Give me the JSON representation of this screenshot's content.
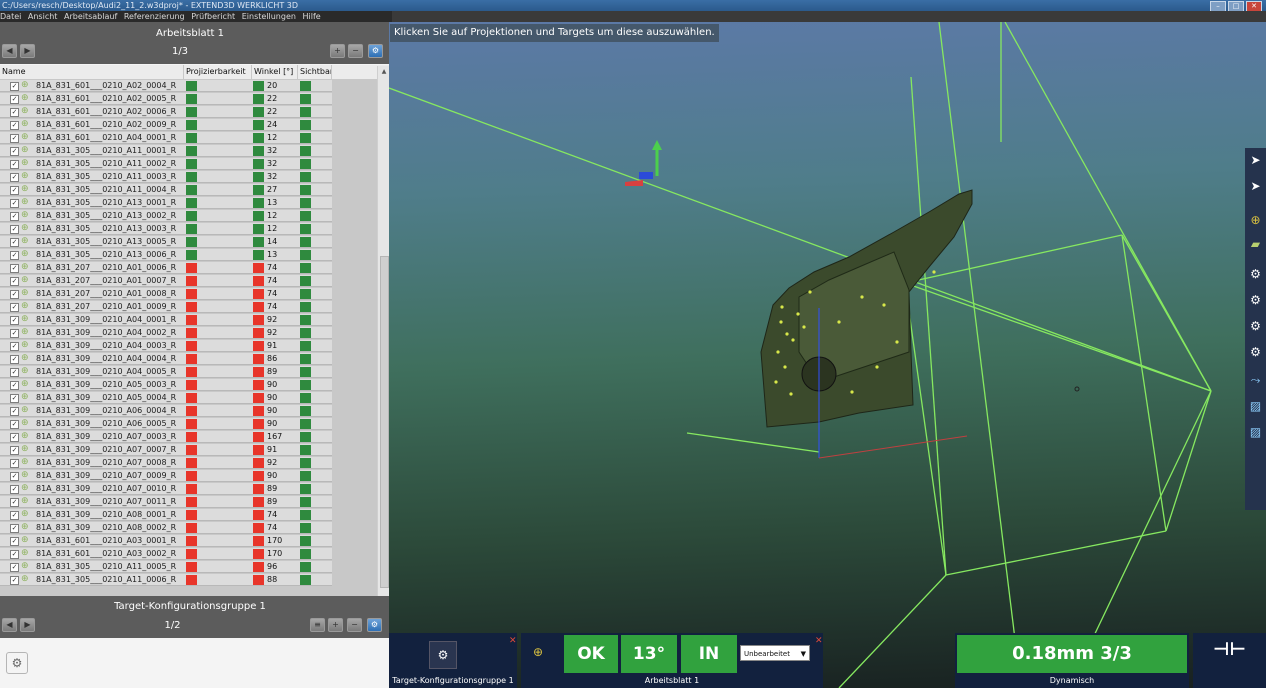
{
  "window": {
    "title": "C:/Users/resch/Desktop/Audi2_11_2.w3dproj* - EXTEND3D WERKLICHT 3D"
  },
  "menu": [
    "Datei",
    "Ansicht",
    "Arbeitsablauf",
    "Referenzierung",
    "Prüfbericht",
    "Einstellungen",
    "Hilfe"
  ],
  "worksheet": {
    "title": "Arbeitsblatt 1",
    "page": "1/3",
    "columns": [
      "Name",
      "Projizierbarkeit",
      "Winkel [°]",
      "Sichtbar"
    ],
    "rows": [
      {
        "name": "81A_831_601___0210_A02_0004_R",
        "ok": true,
        "angle": "20"
      },
      {
        "name": "81A_831_601___0210_A02_0005_R",
        "ok": true,
        "angle": "22"
      },
      {
        "name": "81A_831_601___0210_A02_0006_R",
        "ok": true,
        "angle": "22"
      },
      {
        "name": "81A_831_601___0210_A02_0009_R",
        "ok": true,
        "angle": "24"
      },
      {
        "name": "81A_831_601___0210_A04_0001_R",
        "ok": true,
        "angle": "12"
      },
      {
        "name": "81A_831_305___0210_A11_0001_R",
        "ok": true,
        "angle": "32"
      },
      {
        "name": "81A_831_305___0210_A11_0002_R",
        "ok": true,
        "angle": "32"
      },
      {
        "name": "81A_831_305___0210_A11_0003_R",
        "ok": true,
        "angle": "32"
      },
      {
        "name": "81A_831_305___0210_A11_0004_R",
        "ok": true,
        "angle": "27"
      },
      {
        "name": "81A_831_305___0210_A13_0001_R",
        "ok": true,
        "angle": "13"
      },
      {
        "name": "81A_831_305___0210_A13_0002_R",
        "ok": true,
        "angle": "12"
      },
      {
        "name": "81A_831_305___0210_A13_0003_R",
        "ok": true,
        "angle": "12"
      },
      {
        "name": "81A_831_305___0210_A13_0005_R",
        "ok": true,
        "angle": "14"
      },
      {
        "name": "81A_831_305___0210_A13_0006_R",
        "ok": true,
        "angle": "13"
      },
      {
        "name": "81A_831_207___0210_A01_0006_R",
        "ok": false,
        "angle": "74"
      },
      {
        "name": "81A_831_207___0210_A01_0007_R",
        "ok": false,
        "angle": "74"
      },
      {
        "name": "81A_831_207___0210_A01_0008_R",
        "ok": false,
        "angle": "74"
      },
      {
        "name": "81A_831_207___0210_A01_0009_R",
        "ok": false,
        "angle": "74"
      },
      {
        "name": "81A_831_309___0210_A04_0001_R",
        "ok": false,
        "angle": "92"
      },
      {
        "name": "81A_831_309___0210_A04_0002_R",
        "ok": false,
        "angle": "92"
      },
      {
        "name": "81A_831_309___0210_A04_0003_R",
        "ok": false,
        "angle": "91"
      },
      {
        "name": "81A_831_309___0210_A04_0004_R",
        "ok": false,
        "angle": "86"
      },
      {
        "name": "81A_831_309___0210_A04_0005_R",
        "ok": false,
        "angle": "89"
      },
      {
        "name": "81A_831_309___0210_A05_0003_R",
        "ok": false,
        "angle": "90"
      },
      {
        "name": "81A_831_309___0210_A05_0004_R",
        "ok": false,
        "angle": "90"
      },
      {
        "name": "81A_831_309___0210_A06_0004_R",
        "ok": false,
        "angle": "90"
      },
      {
        "name": "81A_831_309___0210_A06_0005_R",
        "ok": false,
        "angle": "90"
      },
      {
        "name": "81A_831_309___0210_A07_0003_R",
        "ok": false,
        "angle": "167"
      },
      {
        "name": "81A_831_309___0210_A07_0007_R",
        "ok": false,
        "angle": "91"
      },
      {
        "name": "81A_831_309___0210_A07_0008_R",
        "ok": false,
        "angle": "92"
      },
      {
        "name": "81A_831_309___0210_A07_0009_R",
        "ok": false,
        "angle": "90"
      },
      {
        "name": "81A_831_309___0210_A07_0010_R",
        "ok": false,
        "angle": "89"
      },
      {
        "name": "81A_831_309___0210_A07_0011_R",
        "ok": false,
        "angle": "89"
      },
      {
        "name": "81A_831_309___0210_A08_0001_R",
        "ok": false,
        "angle": "74"
      },
      {
        "name": "81A_831_309___0210_A08_0002_R",
        "ok": false,
        "angle": "74"
      },
      {
        "name": "81A_831_601___0210_A03_0001_R",
        "ok": false,
        "angle": "170"
      },
      {
        "name": "81A_831_601___0210_A03_0002_R",
        "ok": false,
        "angle": "170"
      },
      {
        "name": "81A_831_305___0210_A11_0005_R",
        "ok": false,
        "angle": "96"
      },
      {
        "name": "81A_831_305___0210_A11_0006_R",
        "ok": false,
        "angle": "88"
      }
    ]
  },
  "target_group": {
    "title": "Target-Konfigurationsgruppe 1",
    "page": "1/2"
  },
  "viewport": {
    "hint": "Klicken Sie auf Projektionen und Targets um diese auszuwählen."
  },
  "bottom": {
    "tg_label": "Target-Konfigurationsgruppe 1",
    "ws_label": "Arbeitsblatt 1",
    "ok": "OK",
    "angle": "13°",
    "in": "IN",
    "state": "Unbearbeitet",
    "measure": "0.18mm  3/3",
    "mode": "Dynamisch"
  },
  "colors": {
    "ok": "#2f8a3e",
    "fail": "#e8352a",
    "accent": "#31a23e",
    "bottom_bg": "#12213e"
  }
}
